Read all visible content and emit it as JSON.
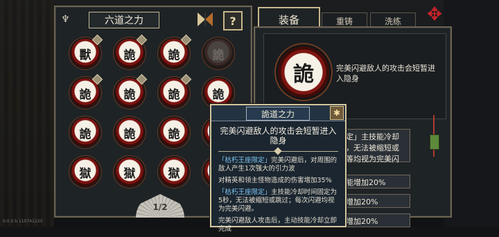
{
  "left_panel": {
    "title": "六道之力",
    "help_label": "?",
    "slots": [
      {
        "glyph": "獸",
        "locked": false
      },
      {
        "glyph": "詭",
        "locked": false
      },
      {
        "glyph": "詭",
        "locked": false
      },
      {
        "glyph": "詭",
        "locked": true
      },
      {
        "glyph": "詭",
        "locked": false
      },
      {
        "glyph": "詭",
        "locked": false
      },
      {
        "glyph": "詭",
        "locked": false
      },
      {
        "glyph": "詭",
        "locked": false
      },
      {
        "glyph": "詭",
        "locked": false
      },
      {
        "glyph": "詭",
        "locked": false
      },
      {
        "glyph": "詭",
        "locked": false
      },
      {
        "glyph": "詭",
        "locked": false
      },
      {
        "glyph": "獄",
        "locked": false
      },
      {
        "glyph": "獄",
        "locked": false
      },
      {
        "glyph": "獄",
        "locked": false
      },
      {
        "glyph": "",
        "locked": false
      }
    ],
    "page": "1/2"
  },
  "right_panel": {
    "tabs": [
      "装备",
      "重铸",
      "洗练"
    ],
    "active_tab": "装备",
    "equipped_glyph": "詭",
    "equipped_desc": "完美闪避敌人的攻击会短暂进入隐身",
    "rows": [
      "定」主技能冷却",
      "，无法被缩短或",
      "等均视为完美闪",
      "能增加20%",
      "增加20%",
      "增加20%"
    ]
  },
  "tooltip": {
    "title": "詭道之力",
    "main": "完美闪避敌人的攻击会短暂进入隐身",
    "lines": [
      {
        "tag": "「枯朽王座限定」",
        "text": "完美闪避后，对周围的敌人产生1次强大的引力波"
      },
      {
        "tag": "",
        "text": "对精英和领主怪物造成的伤害增加35%"
      },
      {
        "tag": "「枯朽王座限定」",
        "text": "主技能冷却时间固定为5秒，无法被缩短或跳过；每次闪避均视为完美闪避。"
      },
      {
        "tag": "",
        "text": "完美闪避敌人攻击后，主动技能冷却立即完成"
      }
    ]
  },
  "corner_text": "0.0.0 b 110741220",
  "colors": {
    "accent_gold": "#c9b68a",
    "seal_red": "#7b1310",
    "highlight_blue": "#7cc4f2"
  }
}
